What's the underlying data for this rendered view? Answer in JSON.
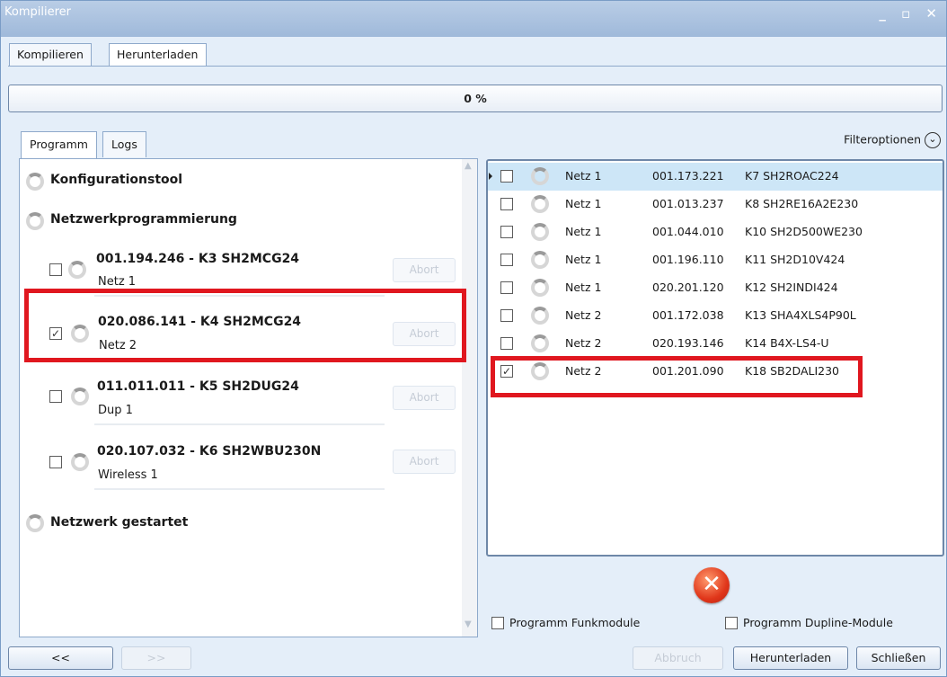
{
  "window": {
    "title": "Kompilierer",
    "controls": "_ ▫ ✕"
  },
  "tabs": [
    "Kompilieren",
    "Herunterladen"
  ],
  "progress": {
    "label": "0 %",
    "value": 0
  },
  "subtabs": [
    "Programm",
    "Logs"
  ],
  "left": {
    "stages": {
      "config": "Konfigurationstool",
      "netprog": "Netzwerkprogrammierung",
      "started": "Netzwerk gestartet"
    },
    "modules": [
      {
        "title": "001.194.246 - K3 SH2MCG24",
        "net": "Netz 1",
        "checked": false,
        "abort": "Abort"
      },
      {
        "title": "020.086.141 - K4 SH2MCG24",
        "net": "Netz 2",
        "checked": true,
        "abort": "Abort"
      },
      {
        "title": "011.011.011 - K5 SH2DUG24",
        "net": "Dup 1",
        "checked": false,
        "abort": "Abort"
      },
      {
        "title": "020.107.032 - K6 SH2WBU230N",
        "net": "Wireless 1",
        "checked": false,
        "abort": "Abort"
      }
    ]
  },
  "filter": {
    "label": "Filteroptionen",
    "icon": "chevron-down-circle-icon"
  },
  "right": {
    "rows": [
      {
        "net": "Netz 1",
        "addr": "001.173.221",
        "name": "K7 SH2ROAC224",
        "checked": false
      },
      {
        "net": "Netz 1",
        "addr": "001.013.237",
        "name": "K8 SH2RE16A2E230",
        "checked": false
      },
      {
        "net": "Netz 1",
        "addr": "001.044.010",
        "name": "K10 SH2D500WE230",
        "checked": false
      },
      {
        "net": "Netz 1",
        "addr": "001.196.110",
        "name": "K11 SH2D10V424",
        "checked": false
      },
      {
        "net": "Netz 1",
        "addr": "020.201.120",
        "name": "K12 SH2INDI424",
        "checked": false
      },
      {
        "net": "Netz 2",
        "addr": "001.172.038",
        "name": "K13 SHA4XLS4P90L",
        "checked": false
      },
      {
        "net": "Netz 2",
        "addr": "020.193.146",
        "name": "K14 B4X-LS4-U",
        "checked": false
      },
      {
        "net": "Netz 2",
        "addr": "001.201.090",
        "name": "K18 SB2DALI230",
        "checked": true
      }
    ],
    "prog_funk": "Programm Funkmodule",
    "prog_dupline": "Programm Dupline-Module"
  },
  "footer": {
    "back": "<<",
    "forward": ">>",
    "abbruch": "Abbruch",
    "download": "Herunterladen",
    "close": "Schließen"
  },
  "colors": {
    "highlight": "#e0171f",
    "error": "#e0361a"
  }
}
